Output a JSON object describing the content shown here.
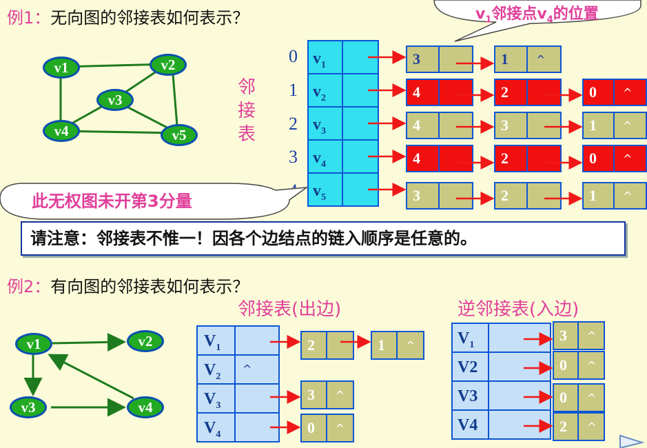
{
  "example1": {
    "label": "例1：",
    "question": "无向图的邻接表如何表示？",
    "graph_nodes": [
      "v1",
      "v2",
      "v3",
      "v4",
      "v5"
    ],
    "side_label": [
      "邻",
      "接",
      "表"
    ],
    "indices": [
      "0",
      "1",
      "2",
      "3",
      "4"
    ],
    "vertices": [
      {
        "name": "v",
        "sub": "1"
      },
      {
        "name": "v",
        "sub": "2"
      },
      {
        "name": "v",
        "sub": "3"
      },
      {
        "name": "v",
        "sub": "4"
      },
      {
        "name": "v",
        "sub": "5"
      }
    ],
    "edges": [
      [
        {
          "v": "3",
          "next": ""
        },
        {
          "v": "1",
          "next": "^"
        }
      ],
      [
        {
          "v": "4",
          "next": ""
        },
        {
          "v": "2",
          "next": ""
        },
        {
          "v": "0",
          "next": "^"
        }
      ],
      [
        {
          "v": "4",
          "next": ""
        },
        {
          "v": "3",
          "next": ""
        },
        {
          "v": "1",
          "next": "^"
        }
      ],
      [
        {
          "v": "4",
          "next": ""
        },
        {
          "v": "2",
          "next": ""
        },
        {
          "v": "0",
          "next": "^"
        }
      ],
      [
        {
          "v": "3",
          "next": ""
        },
        {
          "v": "2",
          "next": ""
        },
        {
          "v": "1",
          "next": "^"
        }
      ]
    ],
    "top_callout": {
      "pre": "v",
      "sub1": "1",
      "mid": "邻接点v",
      "sub2": "4",
      "post": "的位置"
    },
    "weight_callout": "此无权图未开第3分量",
    "note": "请注意：邻接表不惟一！因各个边结点的链入顺序是任意的。"
  },
  "example2": {
    "label": "例2：",
    "question": "有向图的邻接表如何表示？",
    "graph_nodes": [
      "v1",
      "v2",
      "v3",
      "v4"
    ],
    "out_title": "邻接表(出边)",
    "in_title": "逆邻接表(入边)",
    "out_vertices": [
      {
        "name": "V",
        "sub": "1",
        "first": ""
      },
      {
        "name": "V",
        "sub": "2",
        "first": "^"
      },
      {
        "name": "V",
        "sub": "3",
        "first": ""
      },
      {
        "name": "V",
        "sub": "4",
        "first": ""
      }
    ],
    "out_edges": [
      [
        {
          "v": "2",
          "next": ""
        },
        {
          "v": "1",
          "next": "^"
        }
      ],
      [],
      [
        {
          "v": "3",
          "next": "^"
        }
      ],
      [
        {
          "v": "0",
          "next": "^"
        }
      ]
    ],
    "in_vertices": [
      {
        "name": "V",
        "sub": "1"
      },
      {
        "name": "V2",
        "sub": ""
      },
      {
        "name": "V3",
        "sub": ""
      },
      {
        "name": "V4",
        "sub": ""
      }
    ],
    "in_edges": [
      [
        {
          "v": "3",
          "next": "^"
        }
      ],
      [
        {
          "v": "0",
          "next": "^"
        }
      ],
      [
        {
          "v": "0",
          "next": "^"
        }
      ],
      [
        {
          "v": "2",
          "next": "^"
        }
      ]
    ]
  },
  "colors": {
    "pink": "#E0409A",
    "node_green": "#22AA22",
    "cell_cyan": "#33E0EF",
    "cell_blue": "#C6E0F7",
    "node_olive": "#C9C983",
    "node_red": "#F11010",
    "arrow_red": "#F01818"
  }
}
